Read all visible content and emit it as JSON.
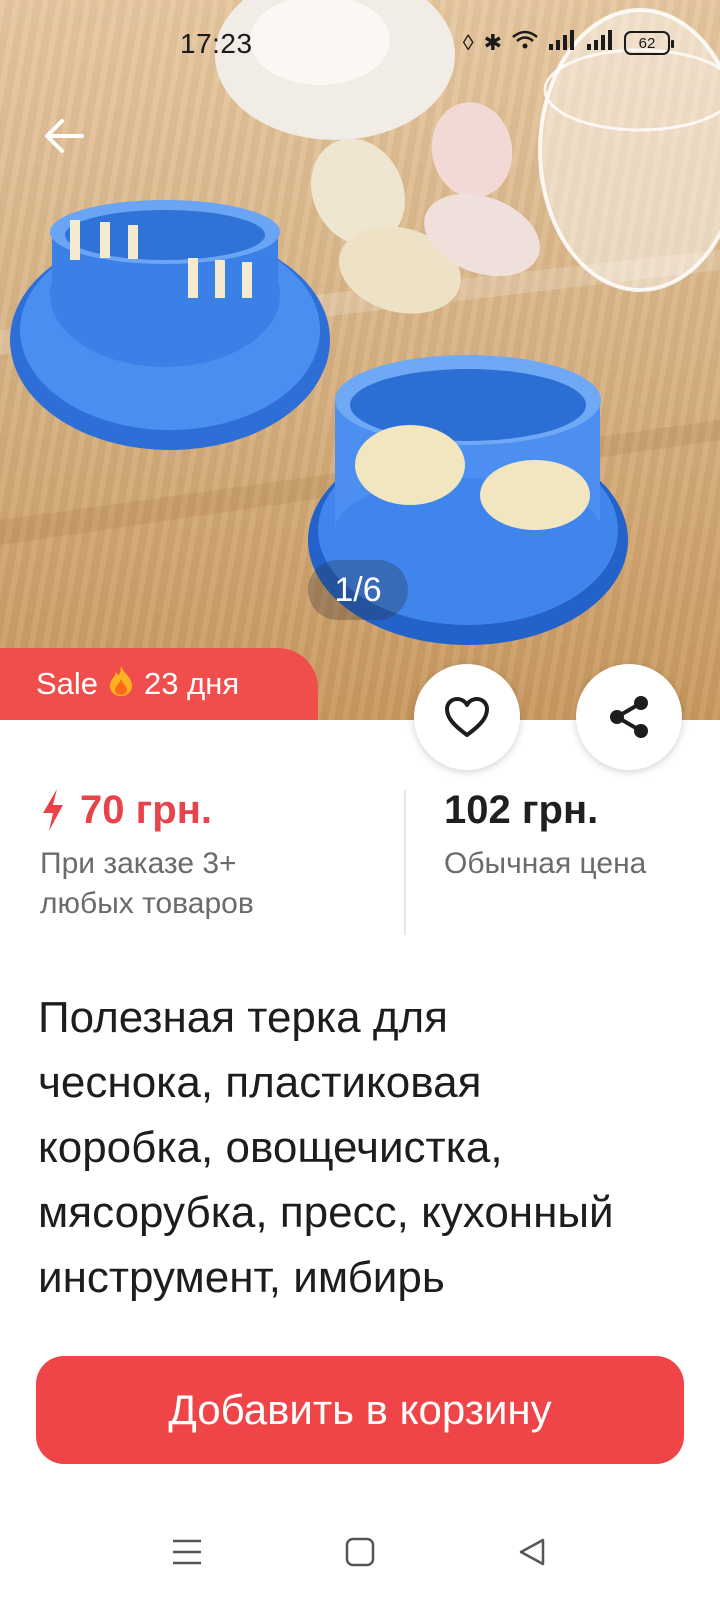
{
  "status_bar": {
    "time": "17:23",
    "battery": "62"
  },
  "gallery": {
    "counter": "1/6"
  },
  "sale_badge": {
    "label": "Sale",
    "days": "23 дня"
  },
  "price": {
    "sale_price": "70 грн.",
    "sale_note_line1": "При заказе 3+",
    "sale_note_line2": "любых товаров",
    "regular_price": "102 грн.",
    "regular_note": "Обычная цена"
  },
  "product": {
    "title_lines": [
      "Полезная терка для",
      "чеснока, пластиковая",
      "коробка, овощечистка,",
      "мясорубка, пресс, кухонный",
      "инструмент, имбирь"
    ]
  },
  "actions": {
    "add_to_cart": "Добавить в корзину"
  },
  "colors": {
    "accent": "#f04548",
    "sale_price": "#e8434b",
    "badge": "#f04d4d"
  },
  "icons": {
    "back": "arrow-left-icon",
    "like": "heart-icon",
    "share": "share-icon",
    "flame": "flame-icon",
    "bolt": "lightning-icon"
  }
}
